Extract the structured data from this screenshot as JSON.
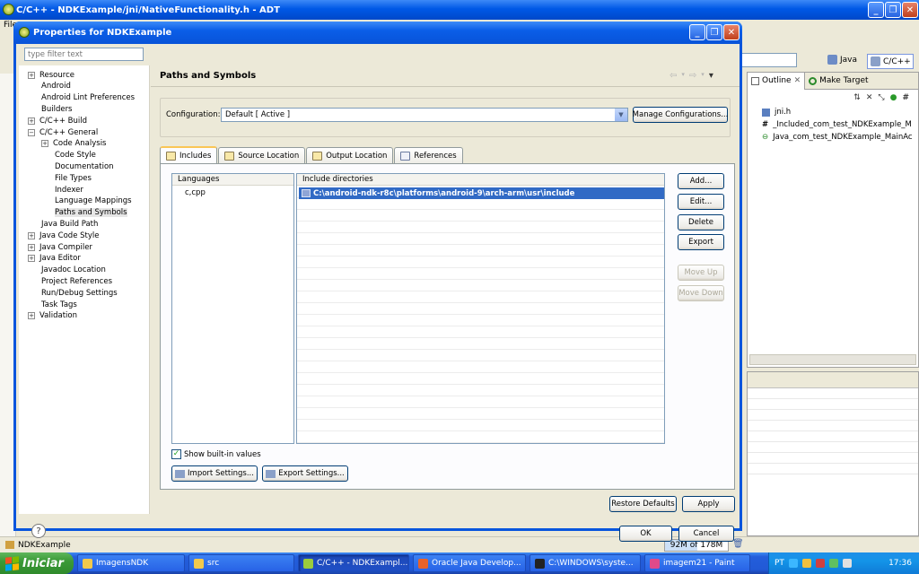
{
  "adt": {
    "title": "C/C++ - NDKExample/jni/NativeFunctionality.h - ADT",
    "menu_fragment": "File",
    "perspective_java": "Java",
    "perspective_cpp": "C/C++",
    "outline_tab": "Outline",
    "make_target_tab": "Make Target",
    "outline_items": [
      "jni.h",
      "_Included_com_test_NDKExample_M",
      "Java_com_test_NDKExample_MainAc"
    ],
    "status_project": "NDKExample",
    "memory": "92M of 178M",
    "memory_fraction": 0.52
  },
  "dialog": {
    "title": "Properties for NDKExample",
    "filter_placeholder": "type filter text",
    "tree": [
      {
        "label": "Resource",
        "expandable": true
      },
      {
        "label": "Android",
        "expandable": false
      },
      {
        "label": "Android Lint Preferences",
        "expandable": false
      },
      {
        "label": "Builders",
        "expandable": false
      },
      {
        "label": "C/C++ Build",
        "expandable": true
      },
      {
        "label": "C/C++ General",
        "expandable": true,
        "expanded": true
      },
      {
        "label": "Code Analysis",
        "expandable": true,
        "indent": 1
      },
      {
        "label": "Code Style",
        "expandable": false,
        "indent": 1
      },
      {
        "label": "Documentation",
        "expandable": false,
        "indent": 1
      },
      {
        "label": "File Types",
        "expandable": false,
        "indent": 1
      },
      {
        "label": "Indexer",
        "expandable": false,
        "indent": 1
      },
      {
        "label": "Language Mappings",
        "expandable": false,
        "indent": 1
      },
      {
        "label": "Paths and Symbols",
        "expandable": false,
        "indent": 1,
        "selected": true
      },
      {
        "label": "Java Build Path",
        "expandable": false
      },
      {
        "label": "Java Code Style",
        "expandable": true
      },
      {
        "label": "Java Compiler",
        "expandable": true
      },
      {
        "label": "Java Editor",
        "expandable": true
      },
      {
        "label": "Javadoc Location",
        "expandable": false
      },
      {
        "label": "Project References",
        "expandable": false
      },
      {
        "label": "Run/Debug Settings",
        "expandable": false
      },
      {
        "label": "Task Tags",
        "expandable": false
      },
      {
        "label": "Validation",
        "expandable": true
      }
    ],
    "page_title": "Paths and Symbols",
    "configuration_label": "Configuration:",
    "configuration_value": "Default  [ Active ]",
    "manage_configurations": "Manage Configurations...",
    "tabs": [
      "Includes",
      "Source Location",
      "Output Location",
      "References"
    ],
    "languages_header": "Languages",
    "language_item": "c,cpp",
    "include_dirs_header": "Include directories",
    "include_dir": "C:\\android-ndk-r8c\\platforms\\android-9\\arch-arm\\usr\\include",
    "side_buttons": {
      "add": "Add...",
      "edit": "Edit...",
      "delete": "Delete",
      "export": "Export",
      "move_up": "Move Up",
      "move_down": "Move Down"
    },
    "show_builtins": "Show built-in values",
    "show_builtins_checked": true,
    "import_settings": "Import Settings...",
    "export_settings": "Export Settings...",
    "restore_defaults": "Restore Defaults",
    "apply": "Apply",
    "ok": "OK",
    "cancel": "Cancel",
    "help": "?"
  },
  "taskbar": {
    "start": "Iniciar",
    "tasks": [
      {
        "label": "ImagensNDK",
        "active": false,
        "color": "#f2c94c"
      },
      {
        "label": "src",
        "active": false,
        "color": "#f2c94c"
      },
      {
        "label": "C/C++ - NDKExampl...",
        "active": true,
        "color": "#9ccc3c"
      },
      {
        "label": "Oracle Java Develop...",
        "active": false,
        "color": "#e8622a"
      },
      {
        "label": "C:\\WINDOWS\\syste...",
        "active": false,
        "color": "#222222"
      },
      {
        "label": "imagem21 - Paint",
        "active": false,
        "color": "#e04a8a"
      }
    ],
    "lang": "PT",
    "time": "17:36"
  }
}
